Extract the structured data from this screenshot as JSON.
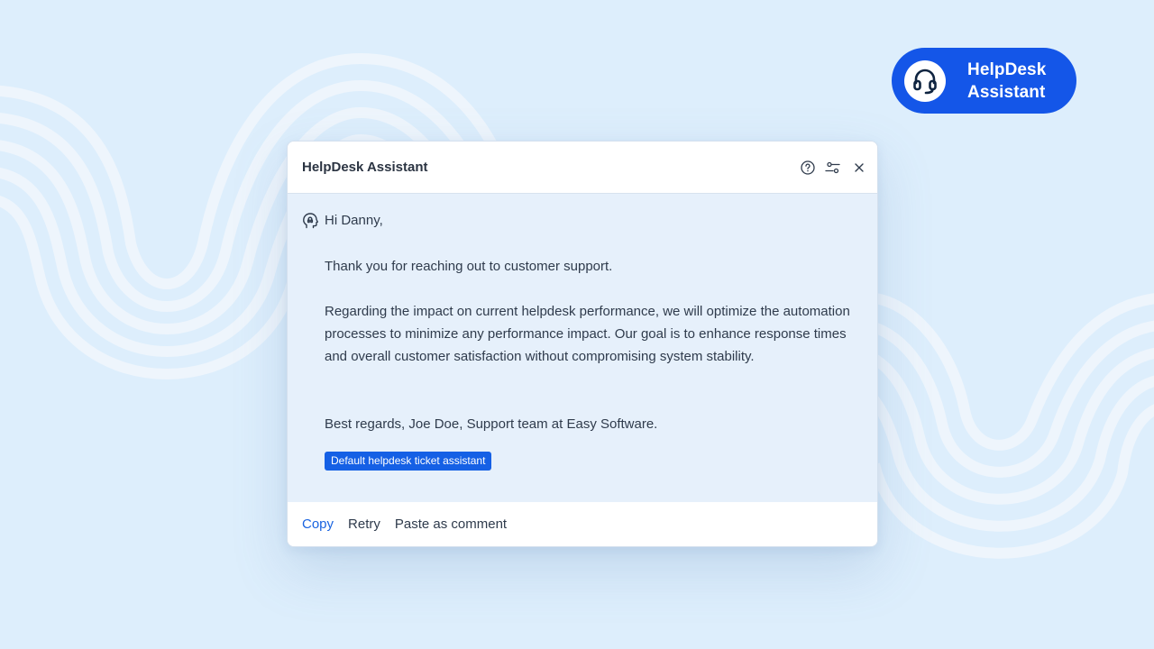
{
  "brand": {
    "line1": "HelpDesk",
    "line2": "Assistant",
    "icon": "headset-icon",
    "color": "#1456e8"
  },
  "dialog": {
    "title": "HelpDesk Assistant",
    "header_icons": [
      "help-circle-icon",
      "settings-sliders-icon",
      "close-icon"
    ],
    "message": {
      "greeting": "Hi Danny,",
      "paragraph1": "Thank you for reaching out to customer support.",
      "paragraph2": "Regarding the impact on current helpdesk performance, we will optimize the automation processes to minimize any performance impact. Our goal is to enhance response times and overall customer satisfaction without compromising system stability.",
      "signature": "Best regards, Joe Doe, Support team at Easy Software."
    },
    "tag": "Default helpdesk ticket assistant",
    "actions": {
      "copy": "Copy",
      "retry": "Retry",
      "paste": "Paste as comment"
    }
  },
  "colors": {
    "background": "#ddeefc",
    "accent": "#1560e5",
    "panel": "#e6f0fb"
  }
}
